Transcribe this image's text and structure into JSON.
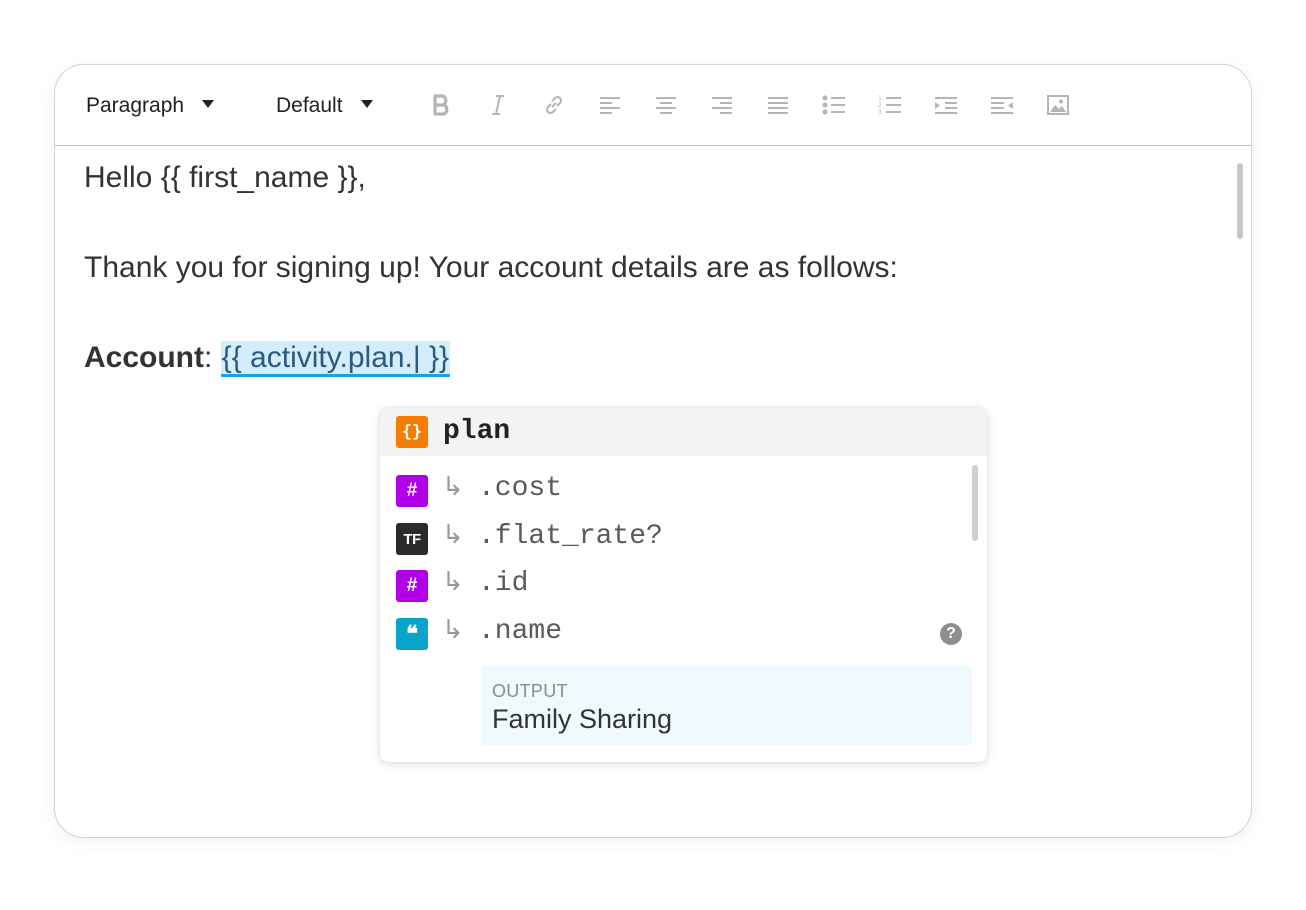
{
  "toolbar": {
    "block_format": "Paragraph",
    "font_family": "Default",
    "buttons": [
      {
        "name": "bold-icon"
      },
      {
        "name": "italic-icon"
      },
      {
        "name": "link-icon"
      },
      {
        "name": "align-left-icon"
      },
      {
        "name": "align-center-icon"
      },
      {
        "name": "align-right-icon"
      },
      {
        "name": "align-justify-icon"
      },
      {
        "name": "bulleted-list-icon"
      },
      {
        "name": "numbered-list-icon"
      },
      {
        "name": "indent-icon"
      },
      {
        "name": "outdent-icon"
      },
      {
        "name": "image-icon"
      }
    ],
    "icon_color": "#b5b5b5"
  },
  "content": {
    "greeting": "Hello {{ first_name }},",
    "body": "Thank you for signing up! Your account details are as follows:",
    "account_label": "Account",
    "account_separator": ": ",
    "account_token": "{{ activity.plan.| }}"
  },
  "autocomplete": {
    "header": {
      "badge_icon": "curly-braces-icon",
      "badge_text": "{}",
      "label": "plan"
    },
    "items": [
      {
        "badge_icon": "number-type-icon",
        "badge_text": "#",
        "arrow": "↳",
        "label": ".cost"
      },
      {
        "badge_icon": "boolean-type-icon",
        "badge_text": "TF",
        "arrow": "↳",
        "label": ".flat_rate?"
      },
      {
        "badge_icon": "number-type-icon",
        "badge_text": "#",
        "arrow": "↳",
        "label": ".id"
      },
      {
        "badge_icon": "string-type-icon",
        "badge_text": "❝",
        "arrow": "↳",
        "label": ".name"
      }
    ],
    "help_text": "?",
    "output": {
      "title": "OUTPUT",
      "value": "Family Sharing"
    }
  },
  "colors": {
    "object_badge": "#f57c00",
    "number_badge": "#b100e8",
    "boolean_badge": "#2b2b2b",
    "string_badge": "#0aa3c9",
    "token_highlight": "#d3edfa",
    "token_underline": "#0ea5e0",
    "output_background": "#f0f9fd"
  }
}
